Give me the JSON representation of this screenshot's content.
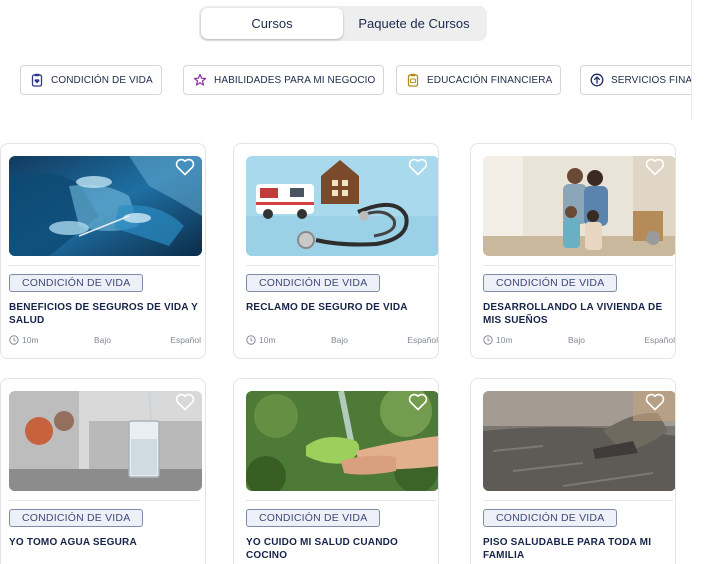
{
  "tabs": {
    "courses": "Cursos",
    "packages": "Paquete de Cursos"
  },
  "categories": [
    {
      "label": "CONDICIÓN DE VIDA",
      "icon": "clipboard-heart-icon",
      "color": "#2f3a8f"
    },
    {
      "label": "HABILIDADES PARA MI NEGOCIO",
      "icon": "star-icon",
      "color": "#8b2fa0"
    },
    {
      "label": "EDUCACIÓN FINANCIERA",
      "icon": "clipboard-money-icon",
      "color": "#b38a1a"
    },
    {
      "label": "SERVICIOS FINANCIEROS",
      "icon": "arrow-up-circle-icon",
      "color": "#1e2a6a"
    }
  ],
  "courses": [
    {
      "tag": "CONDICIÓN DE VIDA",
      "title": "BENEFICIOS DE SEGUROS DE VIDA Y SALUD",
      "duration": "10m",
      "level": "Bajo",
      "language": "Español",
      "image": "surgery-image"
    },
    {
      "tag": "CONDICIÓN DE VIDA",
      "title": "RECLAMO DE SEGURO DE VIDA",
      "duration": "10m",
      "level": "Bajo",
      "language": "Español",
      "image": "ambulance-stethoscope-image"
    },
    {
      "tag": "CONDICIÓN DE VIDA",
      "title": "DESARROLLANDO LA VIVIENDA DE MIS SUEÑOS",
      "duration": "10m",
      "level": "Bajo",
      "language": "Español",
      "image": "family-home-image"
    },
    {
      "tag": "CONDICIÓN DE VIDA",
      "title": "YO TOMO AGUA SEGURA",
      "image": "water-glass-image"
    },
    {
      "tag": "CONDICIÓN DE VIDA",
      "title": "YO CUIDO MI SALUD CUANDO COCINO",
      "image": "washing-vegetables-image"
    },
    {
      "tag": "CONDICIÓN DE VIDA",
      "title": "PISO SALUDABLE PARA TODA MI FAMILIA",
      "image": "concrete-floor-image"
    }
  ],
  "colors": {
    "accent": "#1e2a4a",
    "tag_border": "#7f8aa8",
    "tag_bg": "#eef0f7"
  }
}
